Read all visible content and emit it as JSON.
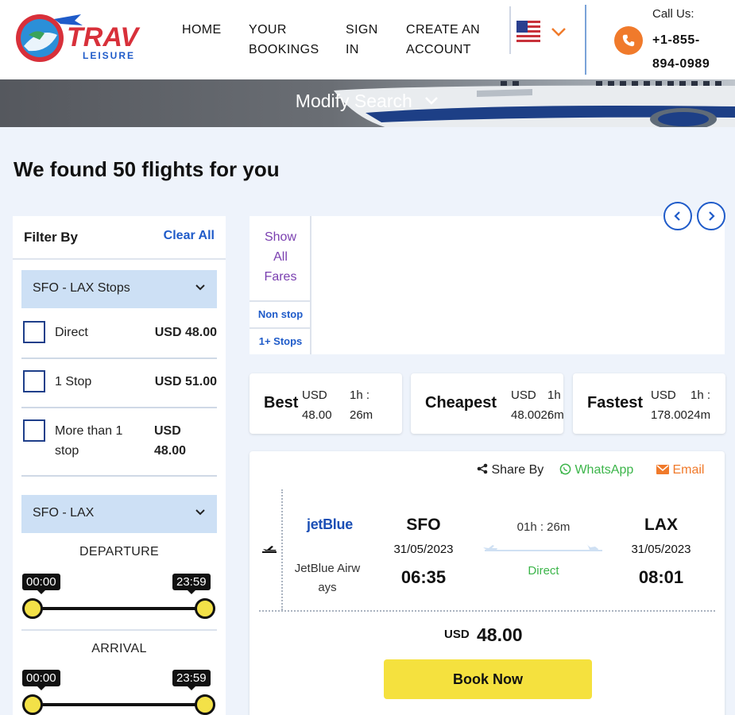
{
  "header": {
    "logo_text": "TRAV",
    "logo_subtext": "LEISURE",
    "nav": [
      {
        "line1": "HOME",
        "line2": ""
      },
      {
        "line1": "YOUR",
        "line2": "BOOKINGS"
      },
      {
        "line1": "SIGN",
        "line2": "IN"
      },
      {
        "line1": "CREATE AN",
        "line2": "ACCOUNT"
      }
    ],
    "locale_icon": "us-flag-icon",
    "call_label": "Call Us:",
    "phone_line1": "+1-855-",
    "phone_line2": "894-0989",
    "accent_color": "#f07a2b",
    "brand_color": "#1f5bc9"
  },
  "hero": {
    "modify_label": "Modify Search"
  },
  "results_title": "We found 50 flights for you",
  "filter": {
    "title": "Filter By",
    "clear_all": "Clear All",
    "stops_section": "SFO - LAX Stops",
    "stops": [
      {
        "label": "Direct",
        "label2": "",
        "price": "USD 48.00",
        "price2": ""
      },
      {
        "label": "1 Stop",
        "label2": "",
        "price": "USD 51.00",
        "price2": ""
      },
      {
        "label": "More than 1",
        "label2": "stop",
        "price": "USD",
        "price2": "48.00"
      }
    ],
    "time_section": "SFO - LAX",
    "departure_label": "DEPARTURE",
    "departure_min": "00:00",
    "departure_max": "23:59",
    "arrival_label": "ARRIVAL",
    "arrival_min": "00:00",
    "arrival_max": "23:59"
  },
  "fares": {
    "show_all_1": "Show",
    "show_all_2": "All",
    "show_all_3": "Fares",
    "non_stop": "Non stop",
    "one_plus_stops": "1+ Stops"
  },
  "sort_tabs": [
    {
      "name": "Best",
      "cur": "USD",
      "amount": "48.00",
      "dur1": "1h :",
      "dur2": "26m"
    },
    {
      "name": "Cheapest",
      "cur": "USD",
      "amount": "48.0026m",
      "dur1": "1h :",
      "dur2": ""
    },
    {
      "name": "Fastest",
      "cur": "USD",
      "amount": "178.0024m",
      "dur1": "1h :",
      "dur2": ""
    }
  ],
  "flight": {
    "share_by": "Share By",
    "whatsapp": "WhatsApp",
    "email": "Email",
    "airline_logo": "jetBlue",
    "airline_name_1": "JetBlue Airw",
    "airline_name_2": "ays",
    "from_code": "SFO",
    "from_date": "31/05/2023",
    "from_time": "06:35",
    "duration": "01h : 26m",
    "stops": "Direct",
    "to_code": "LAX",
    "to_date": "31/05/2023",
    "to_time": "08:01",
    "price_currency": "USD",
    "price_amount": "48.00",
    "book_label": "Book Now"
  }
}
